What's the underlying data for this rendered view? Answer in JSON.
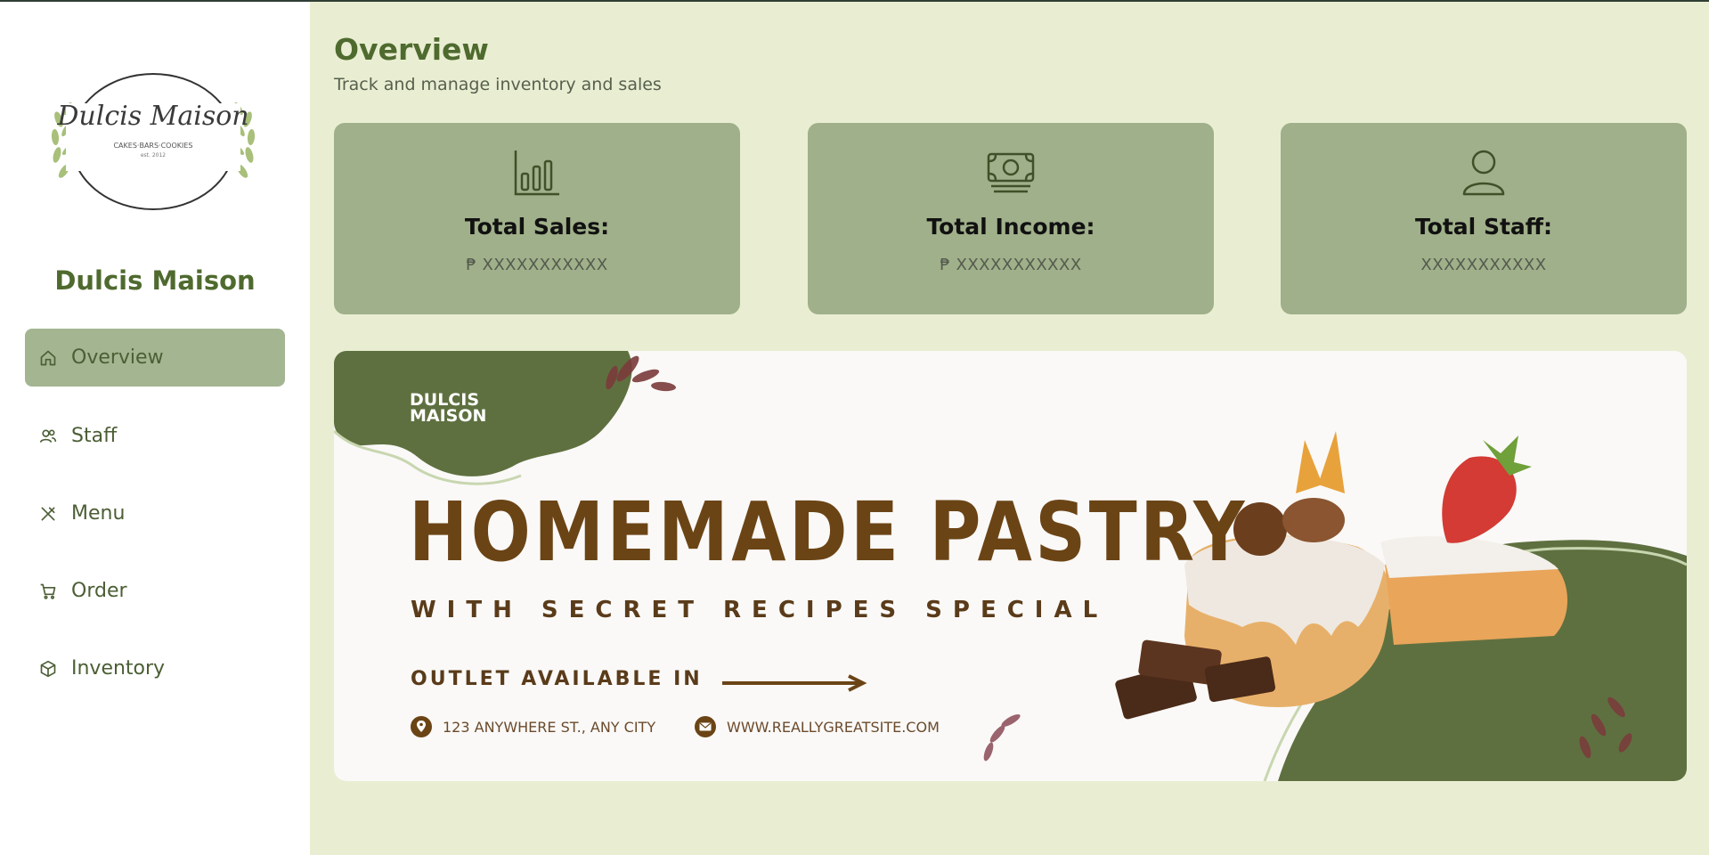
{
  "sidebar": {
    "logo": {
      "script_name": "Dulcis Maison",
      "tagline": "CAKES·BARS·COOKIES",
      "est": "est. 2012"
    },
    "brand_name": "Dulcis Maison",
    "items": [
      {
        "label": "Overview",
        "icon": "home-icon",
        "active": true
      },
      {
        "label": "Staff",
        "icon": "users-icon",
        "active": false
      },
      {
        "label": "Menu",
        "icon": "utensils-icon",
        "active": false
      },
      {
        "label": "Order",
        "icon": "cart-icon",
        "active": false
      },
      {
        "label": "Inventory",
        "icon": "box-icon",
        "active": false
      }
    ]
  },
  "header": {
    "title": "Overview",
    "subtitle": "Track and manage inventory and sales"
  },
  "cards": [
    {
      "title": "Total Sales:",
      "value": "₱ XXXXXXXXXXX",
      "icon": "bar-chart-icon"
    },
    {
      "title": "Total Income:",
      "value": "₱ XXXXXXXXXXX",
      "icon": "money-icon"
    },
    {
      "title": "Total Staff:",
      "value": "XXXXXXXXXXX",
      "icon": "user-icon"
    }
  ],
  "banner": {
    "brand_line1": "DULCIS",
    "brand_line2": "MAISON",
    "headline": "HOMEMADE PASTRY",
    "subheadline": "WITH SECRET RECIPES SPECIAL",
    "outlet": "OUTLET AVAILABLE IN",
    "address": "123 ANYWHERE ST., ANY CITY",
    "website": "WWW.REALLYGREATSITE.COM"
  },
  "colors": {
    "background": "#e9eed2",
    "sidebar": "#ffffff",
    "accent_green": "#4f6a2e",
    "card": "#a0b08a",
    "active_nav": "#a4b592",
    "banner_green": "#5f7040",
    "banner_brown": "#6b4416"
  }
}
